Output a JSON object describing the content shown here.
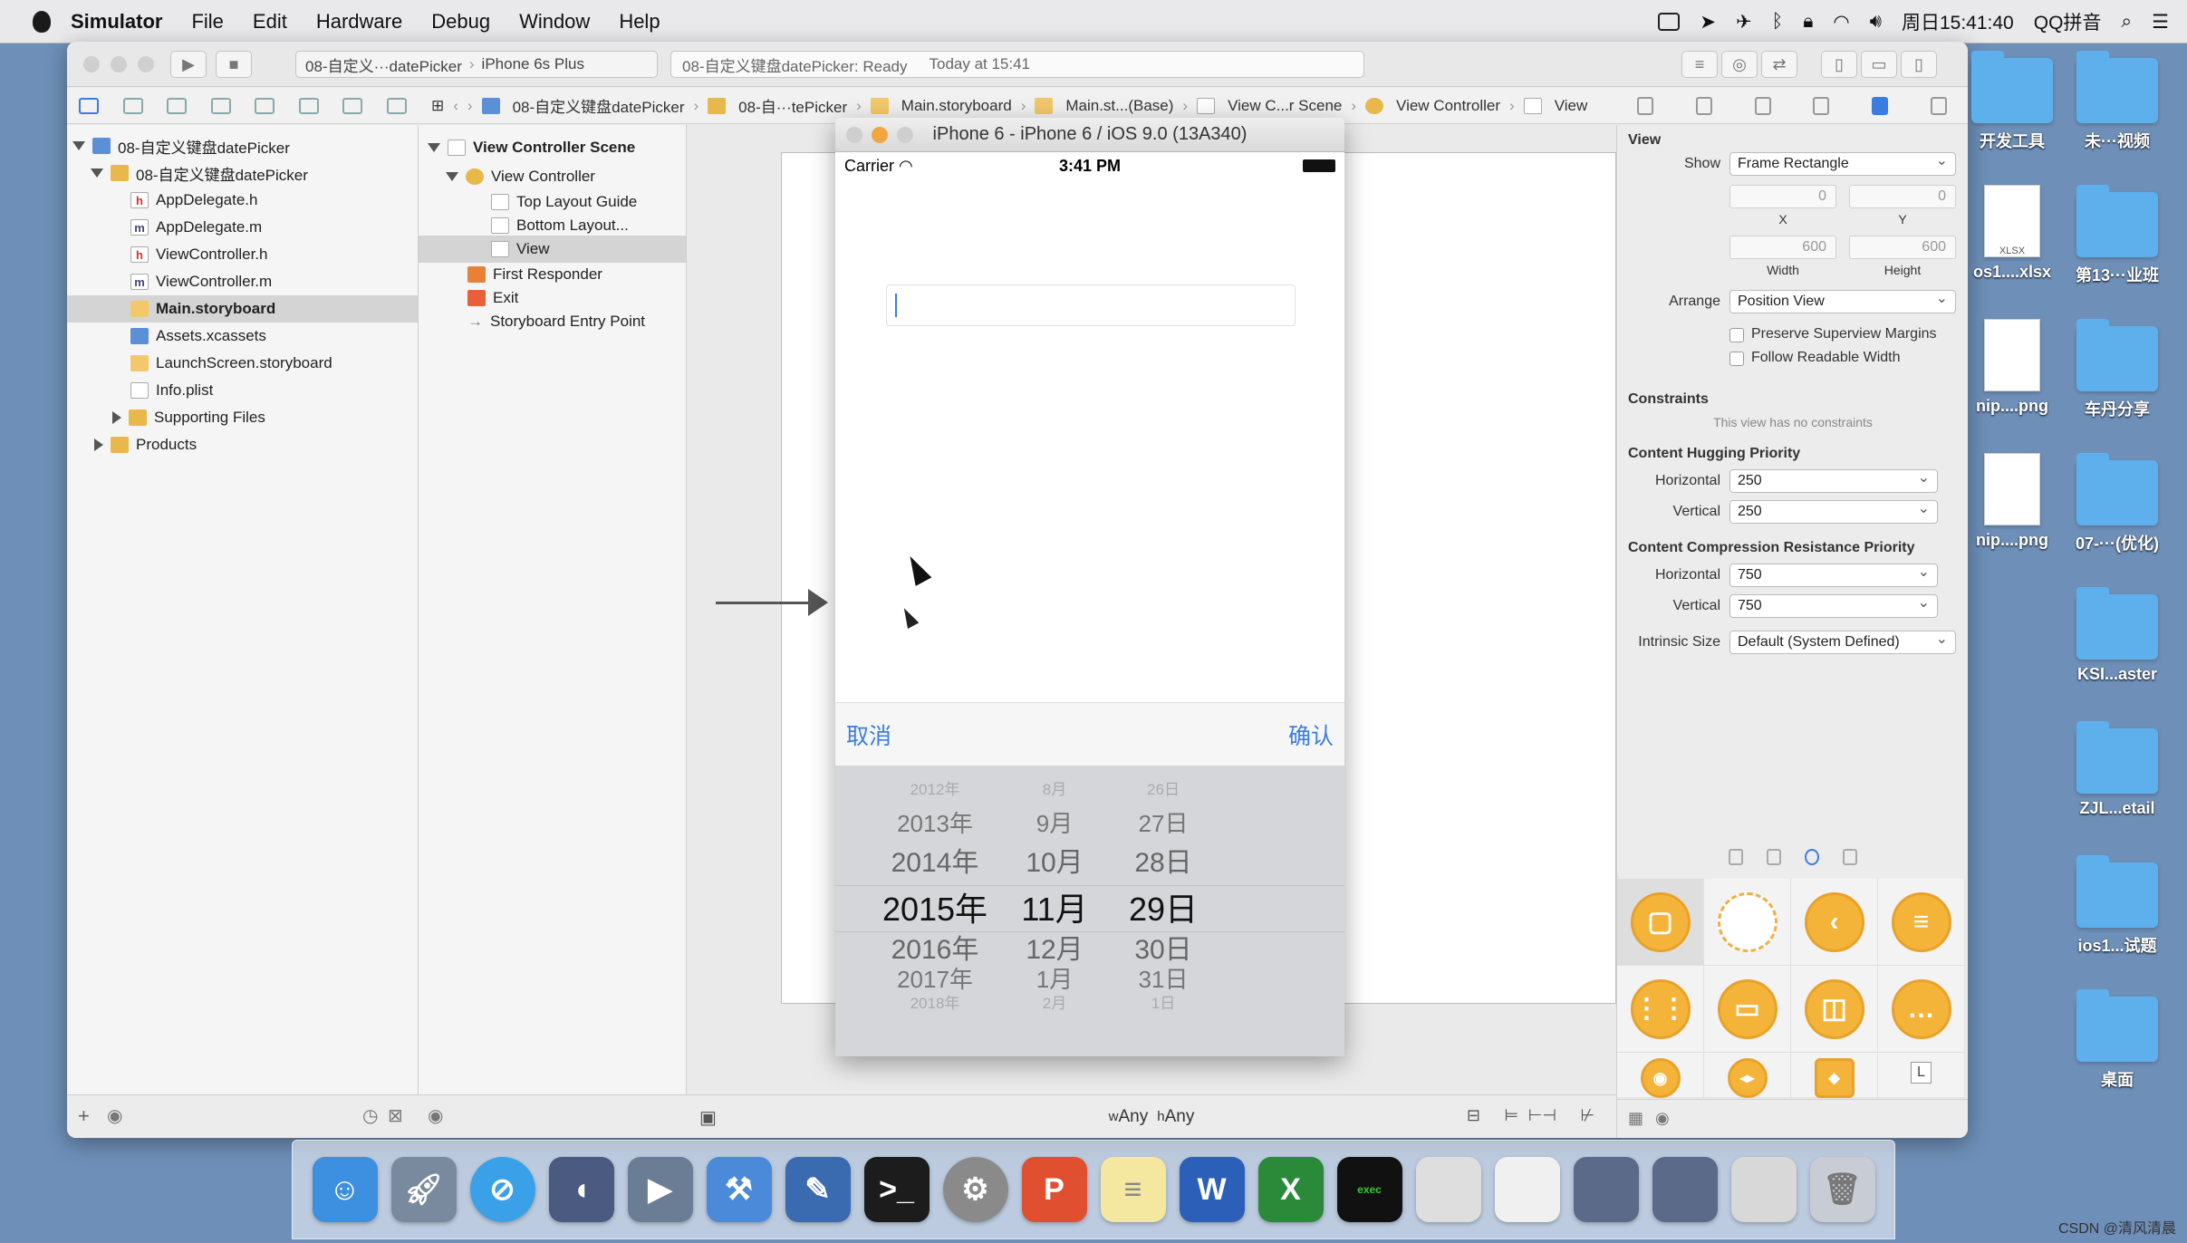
{
  "menubar": {
    "app_name": "Simulator",
    "items": [
      "File",
      "Edit",
      "Hardware",
      "Debug",
      "Window",
      "Help"
    ],
    "clock": "周日15:41:40",
    "input_method": "QQ拼音"
  },
  "toolbar": {
    "scheme": "08-自定义···datePicker",
    "device": "iPhone 6s Plus",
    "status_project": "08-自定义键盘datePicker: Ready",
    "status_time": "Today at 15:41"
  },
  "jumpbar": {
    "crumbs": [
      "08-自定义键盘datePicker",
      "08-自···tePicker",
      "Main.storyboard",
      "Main.st...(Base)",
      "View C...r Scene",
      "View Controller",
      "View"
    ]
  },
  "navigator": {
    "project": "08-自定义键盘datePicker",
    "group": "08-自定义键盘datePicker",
    "files": [
      "AppDelegate.h",
      "AppDelegate.m",
      "ViewController.h",
      "ViewController.m",
      "Main.storyboard",
      "Assets.xcassets",
      "LaunchScreen.storyboard",
      "Info.plist"
    ],
    "supporting": "Supporting Files",
    "products": "Products"
  },
  "outline": {
    "scene": "View Controller Scene",
    "controller": "View Controller",
    "top_guide": "Top Layout Guide",
    "bottom_guide": "Bottom Layout...",
    "view": "View",
    "first_responder": "First Responder",
    "exit": "Exit",
    "entry": "Storyboard Entry Point"
  },
  "canvas": {
    "size_class_w": "Any",
    "size_class_h": "Any",
    "w_prefix": "w",
    "h_prefix": "h"
  },
  "simulator": {
    "title": "iPhone 6 - iPhone 6 / iOS 9.0 (13A340)",
    "carrier": "Carrier",
    "time": "3:41 PM",
    "cancel": "取消",
    "confirm": "确认",
    "picker": {
      "years": [
        "2012年",
        "2013年",
        "2014年",
        "2015年",
        "2016年",
        "2017年",
        "2018年"
      ],
      "months": [
        "8月",
        "9月",
        "10月",
        "11月",
        "12月",
        "1月",
        "2月"
      ],
      "days": [
        "26日",
        "27日",
        "28日",
        "29日",
        "30日",
        "31日",
        "1日"
      ],
      "selected_index": 3
    }
  },
  "inspector": {
    "section": "View",
    "show_label": "Show",
    "show_value": "Frame Rectangle",
    "x_value": "0",
    "y_value": "0",
    "x_label": "X",
    "y_label": "Y",
    "width_value": "600",
    "height_value": "600",
    "width_label": "Width",
    "height_label": "Height",
    "arrange_label": "Arrange",
    "arrange_value": "Position View",
    "preserve": "Preserve Superview Margins",
    "follow": "Follow Readable Width",
    "constraints_title": "Constraints",
    "constraints_note": "This view has no constraints",
    "hugging_title": "Content Hugging Priority",
    "compression_title": "Content Compression Resistance Priority",
    "horizontal": "Horizontal",
    "vertical": "Vertical",
    "hug_h": "250",
    "hug_v": "250",
    "comp_h": "750",
    "comp_v": "750",
    "intrinsic_label": "Intrinsic Size",
    "intrinsic_value": "Default (System Defined)",
    "library_last_label": "L"
  },
  "desktop": {
    "icons": [
      "开发工具",
      "未···视频",
      "os1....xlsx",
      "第13···业班",
      "nip....png",
      "车丹分享",
      "nip....png",
      "07-···(优化)",
      "KSI...aster",
      "ZJL...etail",
      "ios1...试题",
      "桌面"
    ],
    "xlsx_badge": "XLSX"
  },
  "dock": {
    "exec_label": "exec"
  },
  "watermark": "CSDN @清风清晨",
  "colors": {
    "accent": "#3a7de0",
    "library_orange": "#f4b43a",
    "desktop": "#6e8fb8"
  }
}
